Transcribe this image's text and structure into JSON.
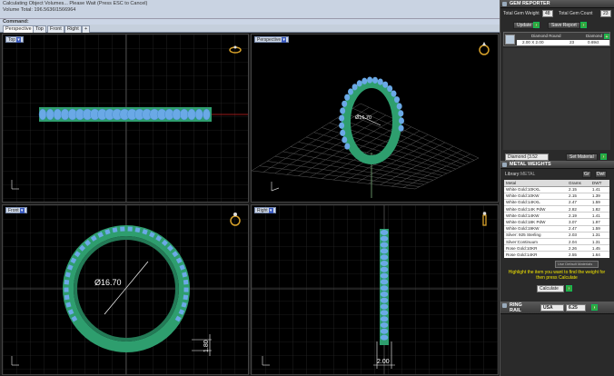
{
  "command": {
    "line1": "Calculating Object Volumes... Please Wait (Press ESC to Cancel)",
    "line2": "Volume Total: 196.5636I1566964",
    "prompt": "Command:"
  },
  "tabs": [
    "Perspective",
    "Top",
    "Front",
    "Right",
    "+"
  ],
  "viewports": {
    "top": {
      "label": "Top"
    },
    "perspective": {
      "label": "Perspective",
      "dim": "Ø16.70"
    },
    "front": {
      "label": "Front",
      "dim_diameter": "Ø16.70",
      "dim_thickness": "1.80"
    },
    "right": {
      "label": "Right",
      "dim_width": "2.00"
    }
  },
  "gem_reporter": {
    "title": "GEM REPORTER",
    "total_weight_label": "Total Gem Weight",
    "total_weight_value": "48",
    "total_count_label": "Total Gem Count",
    "total_count_value": "23",
    "update_label": "Update",
    "save_label": "Save Report",
    "col_shape": "Diamond Round",
    "col_type": "Diamond",
    "row_size": "2.00 X 2.00",
    "row_count": "23",
    "row_weight": "0.69ct",
    "material": "Diamond (3.52 g/g)",
    "set_material": "Set Material"
  },
  "metal_weights": {
    "title": "METAL WEIGHTS",
    "library_label": "Library:",
    "library_value": "METAL",
    "sort_labels": [
      "Gr",
      "Dwt"
    ],
    "columns": [
      "Metal",
      "Grams",
      "DWT"
    ],
    "rows": [
      [
        "White Gold:10KXL",
        "2.15",
        "1.41"
      ],
      [
        "White Gold:10KW",
        "2.15",
        "1.39"
      ],
      [
        "White Gold:14KXL",
        "2.47",
        "1.59"
      ],
      [
        "White Gold:14K PdW",
        "2.82",
        "1.82"
      ],
      [
        "White Gold:14KW",
        "2.19",
        "1.41"
      ],
      [
        "White Gold:18K PdW",
        "3.07",
        "1.97"
      ],
      [
        "White Gold:19KW",
        "2.47",
        "1.59"
      ],
      [
        "Silver: 925 Sterling",
        "2.03",
        "1.31"
      ],
      [
        "Silver:Continuum",
        "2.04",
        "1.31"
      ],
      [
        "Rose Gold:10KR",
        "2.26",
        "1.45"
      ],
      [
        "Rose Gold:14KR",
        "2.55",
        "1.64"
      ]
    ],
    "use_default": "Use Default Materials",
    "hint": "Highlight the item you want to find the weight for then press Calculate",
    "calculate": "Calculate"
  },
  "ring_rail": {
    "title": "RING RAIL",
    "region": "USA",
    "size": "6.25"
  },
  "colors": {
    "band": "#2e9e6e",
    "gem": "#6aa9e6",
    "grid": "#3a3a3a",
    "axis_red": "#c22",
    "highlight": "#f2e500"
  }
}
